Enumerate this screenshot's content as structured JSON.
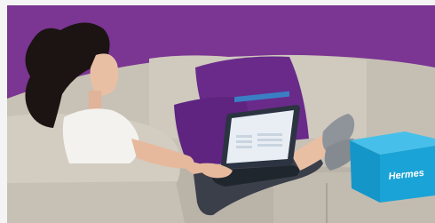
{
  "photo": {
    "box_brand_text": "Hermes",
    "colors": {
      "wall": "#7b3592",
      "sofa": "#c9c3b8",
      "cushion": "#6a2a8a",
      "box": "#1aa3d6",
      "laptop": "#2b3440",
      "hair": "#1b1412",
      "sock": "#8f939a"
    }
  }
}
